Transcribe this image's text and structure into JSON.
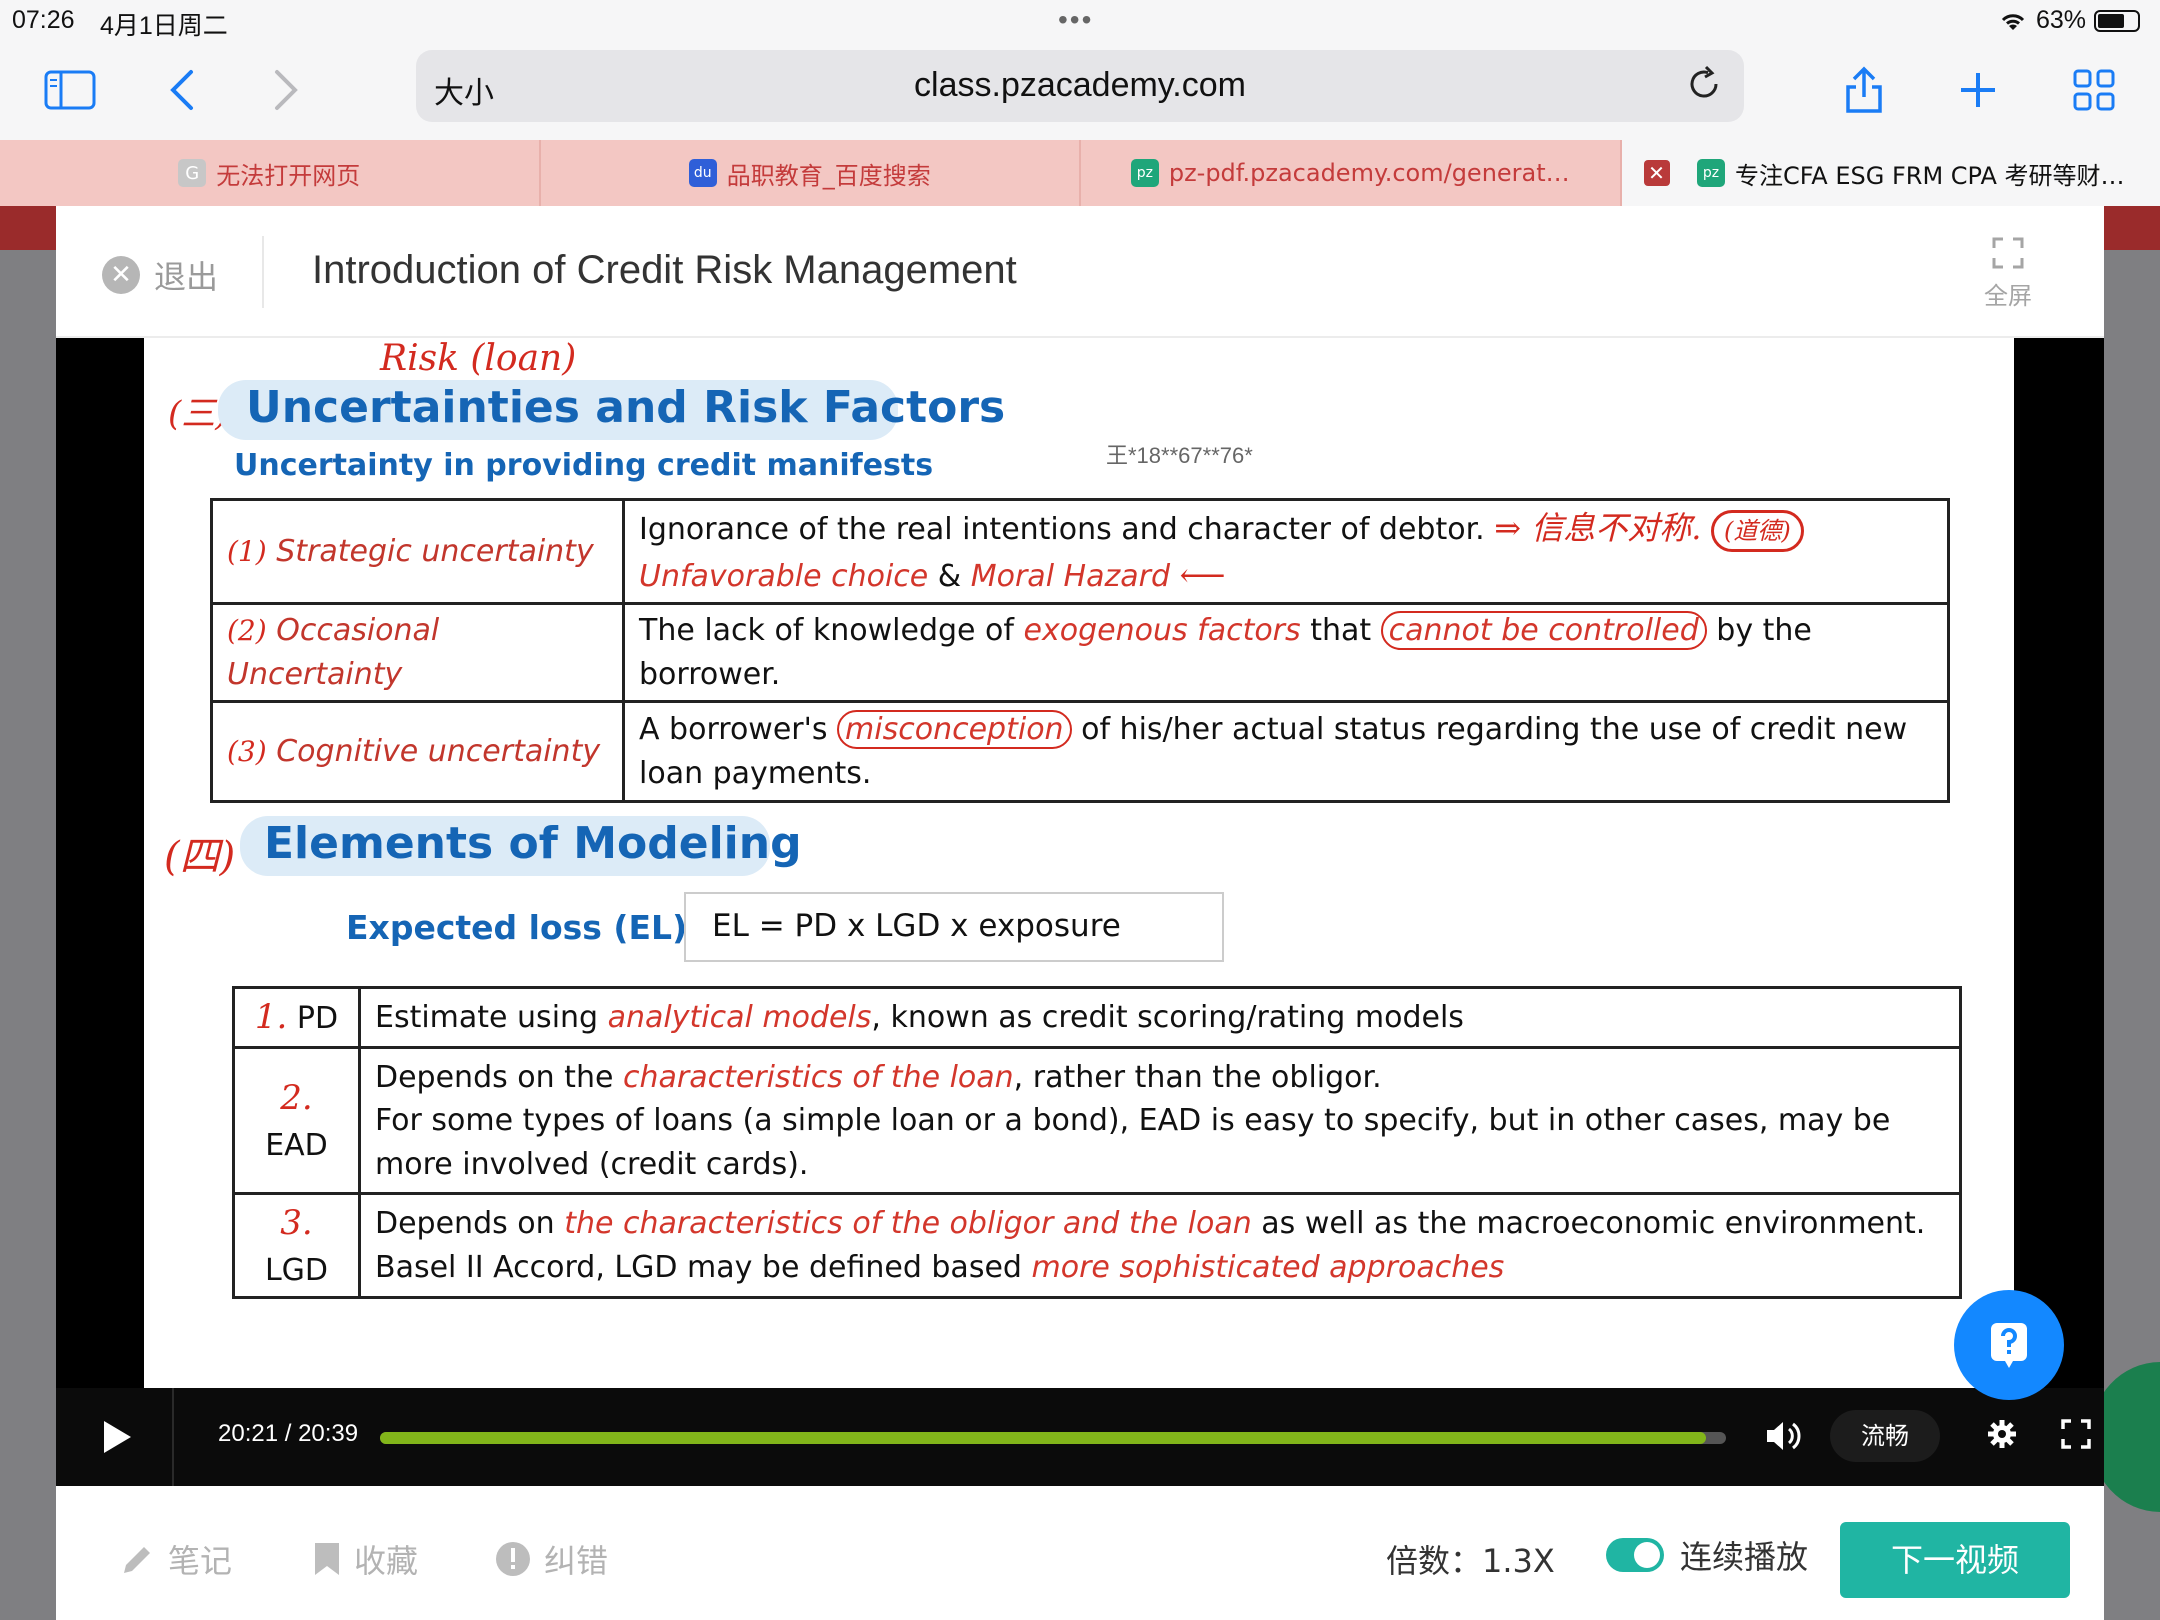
{
  "status": {
    "time": "07:26",
    "date": "4月1日周二",
    "battery": "63%"
  },
  "browser": {
    "size_label": "大小",
    "url": "class.pzacademy.com",
    "tabs": [
      {
        "label": "无法打开网页",
        "favicon": "G"
      },
      {
        "label": "品职教育_百度搜索",
        "favicon": "du"
      },
      {
        "label": "pz-pdf.pzacademy.com/generat…",
        "favicon": "pz"
      },
      {
        "label": "专注CFA ESG FRM CPA 考研等财…",
        "favicon": "pz",
        "close": "✕"
      }
    ]
  },
  "header": {
    "exit_label": "退出",
    "title": "Introduction of Credit Risk Management",
    "fullscreen_label": "全屏"
  },
  "slide": {
    "section3_num": "(三)",
    "section3_title": "Uncertainties and Risk Factors",
    "section3_sub": "Uncertainty in providing credit manifests",
    "watermark": "王*18**67**76*",
    "annot_risk": "Risk (loan)",
    "uncertainty_rows": [
      {
        "num": "(1)",
        "label": "Strategic uncertainty",
        "text1": "Ignorance of the real intentions and character of debtor.",
        "text2a": "Unfavorable choice",
        "text2b": " & ",
        "text2c": "Moral Hazard",
        "note": "⇒ 信息不对称.",
        "circled": "(道德)"
      },
      {
        "num": "(2)",
        "label": "Occasional Uncertainty",
        "t1": "The lack of knowledge of ",
        "t2": "exogenous factors",
        "t3": " that ",
        "t4": "cannot be controlled",
        "t5": " by the borrower."
      },
      {
        "num": "(3)",
        "label": "Cognitive uncertainty",
        "t1": "A borrower's ",
        "t2": "misconception",
        "t3": " of his/her actual status regarding the use of credit new loan payments."
      }
    ],
    "section4_num": "(四)",
    "section4_title": "Elements of Modeling",
    "el_label": "Expected loss (EL)",
    "el_formula": "EL = PD x LGD x exposure",
    "model_rows": [
      {
        "num": "1.",
        "label": "PD",
        "a": "Estimate using ",
        "b": "analytical models",
        "c": ", known as credit scoring/rating models"
      },
      {
        "num": "2.",
        "label": "EAD",
        "a": "Depends on the ",
        "b": "characteristics of the loan",
        "c": ", rather than the obligor.",
        "d": "For some types of loans (a simple loan or a bond), EAD is easy to specify, but in other cases, may be more involved (credit cards)."
      },
      {
        "num": "3.",
        "label": "LGD",
        "a": "Depends on ",
        "b": "the characteristics of the obligor and the loan",
        "c": " as well as the macroeconomic environment.",
        "d": "Basel II Accord, LGD may be defined based ",
        "e": "more sophisticated approaches"
      }
    ]
  },
  "player": {
    "time": "20:21 / 20:39",
    "progress_fraction": 0.985,
    "quality": "流畅"
  },
  "footer": {
    "note": "笔记",
    "favorite": "收藏",
    "report": "纠错",
    "speed": "倍数：1.3X",
    "autoplay": "连续播放",
    "next": "下一视频"
  },
  "colors": {
    "accent": "#20b5a3",
    "tab_bg": "#f3c7c3",
    "slide_heading": "#1565b5",
    "annotation": "#d32a1f",
    "progress": "#82b51a"
  }
}
